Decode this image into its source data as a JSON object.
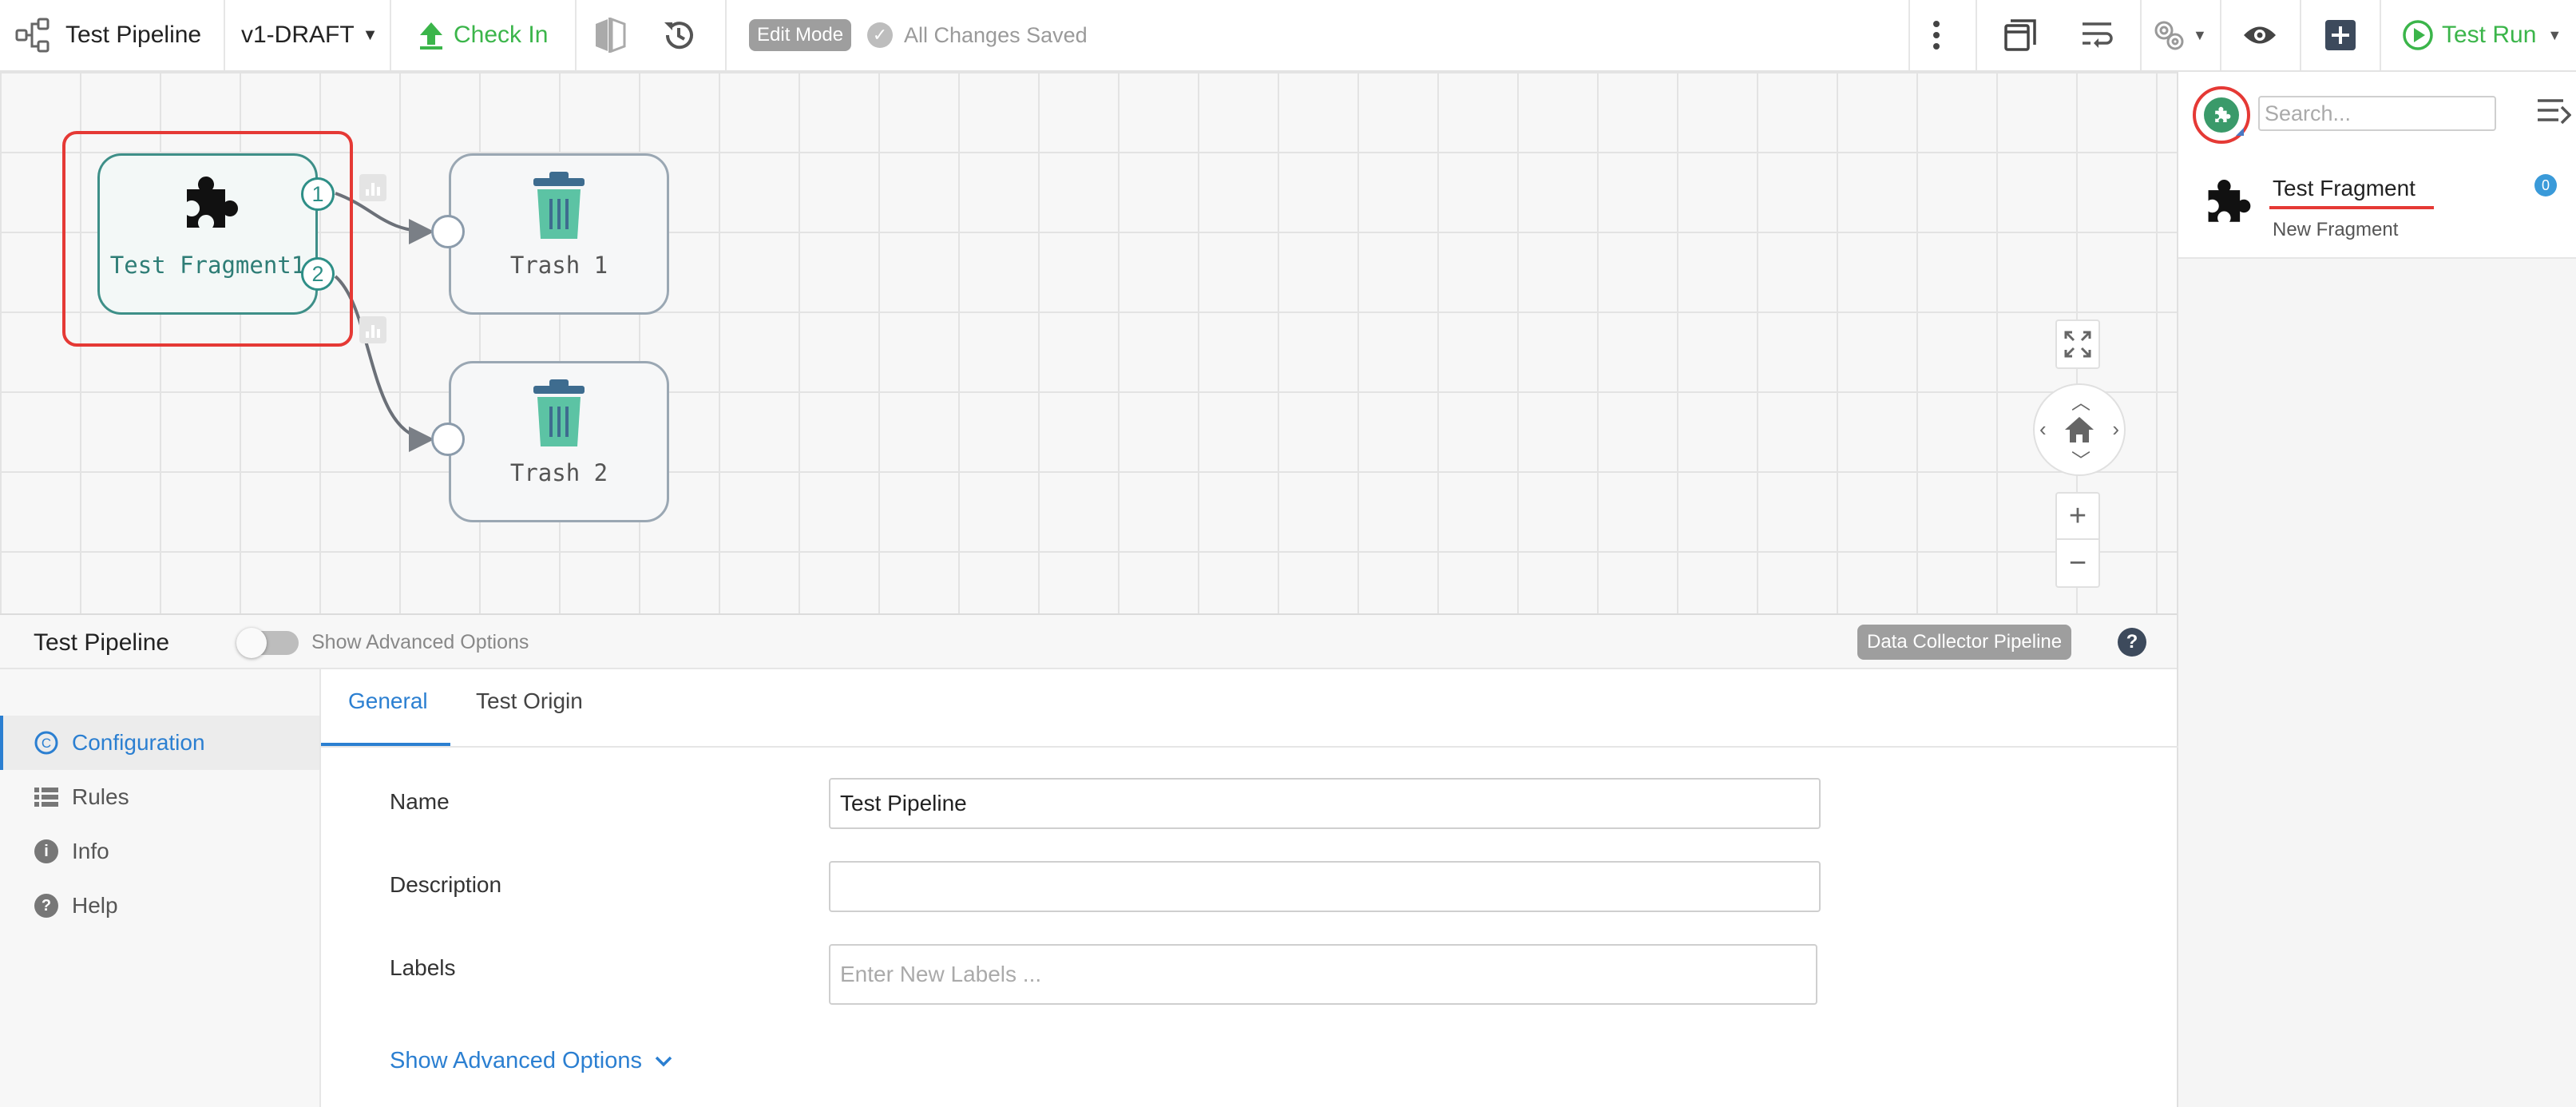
{
  "toolbar": {
    "pipeline_title": "Test Pipeline",
    "version": "v1-DRAFT",
    "check_in": "Check In",
    "edit_mode": "Edit Mode",
    "saved_status": "All Changes Saved",
    "test_run": "Test Run"
  },
  "canvas": {
    "nodes": [
      {
        "label": "Test Fragment1",
        "icon": "puzzle-icon",
        "outputs": [
          "1",
          "2"
        ]
      },
      {
        "label": "Trash 1",
        "icon": "trash-icon"
      },
      {
        "label": "Trash 2",
        "icon": "trash-icon"
      }
    ]
  },
  "library": {
    "search_placeholder": "Search...",
    "items": [
      {
        "name": "Test Fragment",
        "subtitle": "New Fragment",
        "count": "0",
        "icon": "puzzle-icon"
      }
    ]
  },
  "config": {
    "title": "Test Pipeline",
    "show_advanced": "Show Advanced Options",
    "pipeline_type": "Data Collector Pipeline",
    "nav": [
      {
        "label": "Configuration",
        "icon": "configuration-icon"
      },
      {
        "label": "Rules",
        "icon": "list-icon"
      },
      {
        "label": "Info",
        "icon": "info-icon"
      },
      {
        "label": "Help",
        "icon": "help-icon"
      }
    ],
    "tabs": [
      "General",
      "Test Origin"
    ],
    "fields": {
      "name_label": "Name",
      "name_value": "Test Pipeline",
      "description_label": "Description",
      "description_value": "",
      "labels_label": "Labels",
      "labels_placeholder": "Enter New Labels ..."
    },
    "advanced_link": "Show Advanced Options"
  },
  "colors": {
    "accent_blue": "#2b7fd1",
    "accent_green": "#3bb54a",
    "fragment_teal": "#2e8f87",
    "trash_teal": "#5cc3a4",
    "trash_lid": "#3e6c8f",
    "highlight_red": "#e53935"
  }
}
